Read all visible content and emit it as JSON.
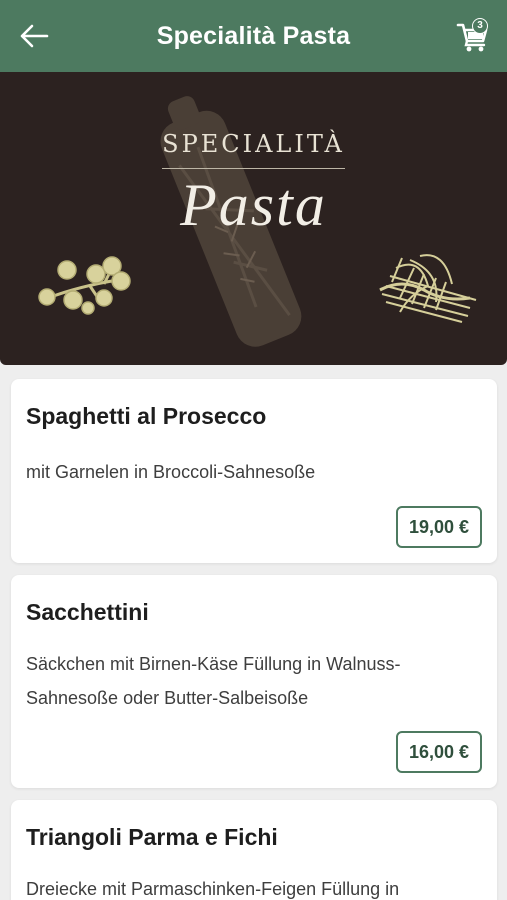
{
  "header": {
    "title": "Specialità Pasta",
    "back_icon": "arrow-left-icon",
    "cart_icon": "shopping-cart-icon",
    "cart_count": "3",
    "background_color": "#4d7a60"
  },
  "banner": {
    "subtitle": "SPECIALITÀ",
    "title": "Pasta",
    "background_color": "#2c2220"
  },
  "items": [
    {
      "name": "Spaghetti al Prosecco",
      "description": "mit Garnelen in Broccoli-Sahnesoße",
      "price": "19,00 €"
    },
    {
      "name": "Sacchettini",
      "description": "Säckchen mit Birnen-Käse Füllung in Walnuss-Sahnesoße oder Butter-Salbeisoße",
      "price": "16,00 €"
    },
    {
      "name": "Triangoli Parma e Fichi",
      "description": "Dreiecke mit Parmaschinken-Feigen Füllung in"
    }
  ]
}
